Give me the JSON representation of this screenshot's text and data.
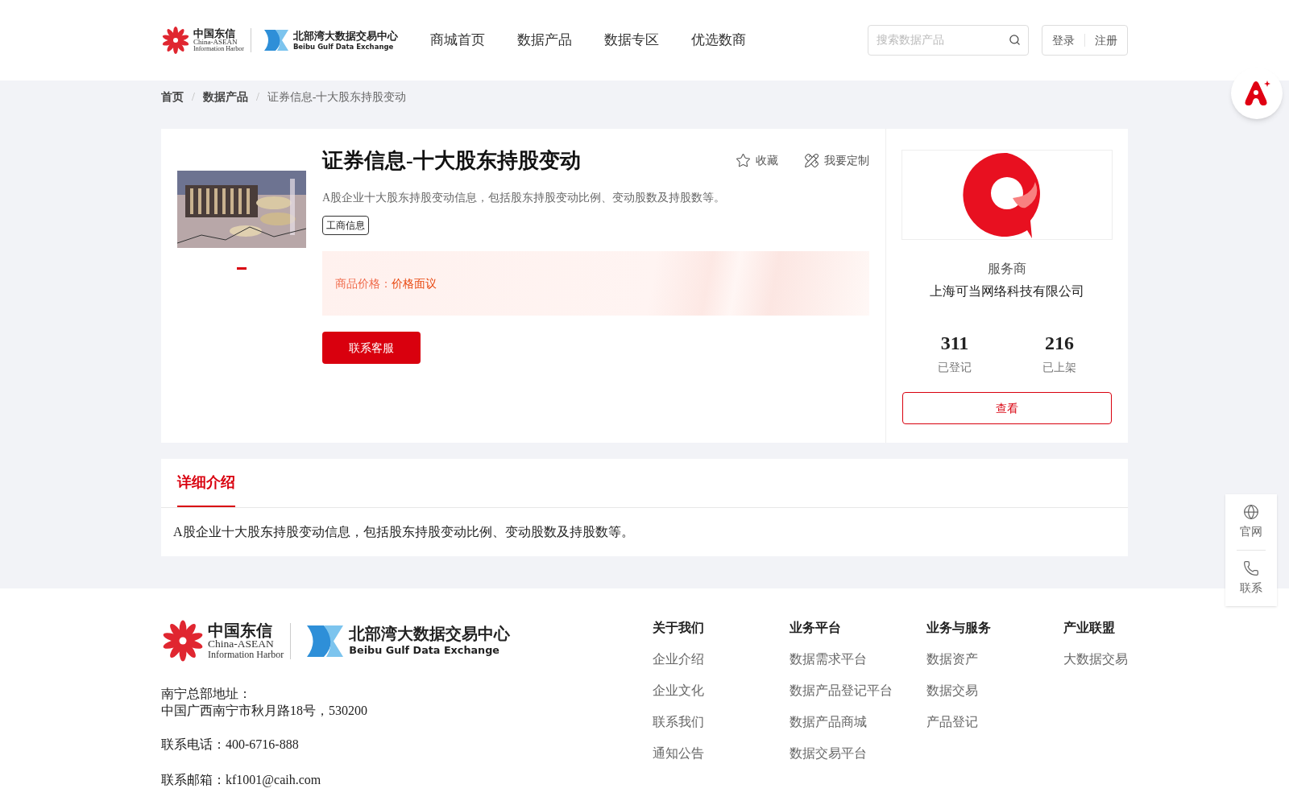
{
  "header": {
    "logo": {
      "brand_cn": "中国东信",
      "brand_en": "China-ASEAN",
      "brand_sub": "Information Harbor",
      "exchange_cn": "北部湾大数据交易中心",
      "exchange_en": "Beibu Gulf Data Exchange"
    },
    "nav": [
      "商城首页",
      "数据产品",
      "数据专区",
      "优选数商"
    ],
    "search": {
      "placeholder": "搜索数据产品"
    },
    "auth": [
      "登录",
      "注册"
    ]
  },
  "breadcrumb": [
    {
      "label": "首页"
    },
    {
      "separator": "/",
      "label": "数据产品"
    },
    {
      "separator": "/",
      "label": "证券信息-十大股东持股变动"
    }
  ],
  "product": {
    "title": "证券信息-十大股东持股变动",
    "actions": [
      {
        "label": "收藏",
        "kind": "star"
      },
      {
        "label": "我要定制",
        "kind": "customize"
      }
    ],
    "description": "A股企业十大股东持股变动信息，包括股东持股变动比例、变动股数及持股数等。",
    "tags": [
      "工商信息"
    ],
    "price_label": "商品价格：",
    "price_value": "价格面议",
    "contact_button": "联系客服"
  },
  "provider": {
    "role": "服务商",
    "name": "上海可当网络科技有限公司",
    "stats": [
      {
        "value": "311",
        "label": "已登记"
      },
      {
        "value": "216",
        "label": "已上架"
      }
    ],
    "view_button": "查看"
  },
  "detail": {
    "tabs": [
      {
        "label": "详细介绍",
        "selected": true
      }
    ],
    "body": "A股企业十大股东持股变动信息，包括股东持股变动比例、变动股数及持股数等。"
  },
  "footer": {
    "logo": {
      "brand_cn": "中国东信",
      "brand_en": "China-ASEAN",
      "brand_sub": "Information Harbor",
      "exchange_cn": "北部湾大数据交易中心",
      "exchange_en": "Beibu Gulf Data Exchange"
    },
    "address_label": "南宁总部地址：",
    "address": "中国广西南宁市秋月路18号，530200",
    "phone": "联系电话：400-6716-888",
    "email": "联系邮箱：kf1001@caih.com",
    "columns": [
      {
        "heading": "关于我们",
        "links": [
          "企业介绍",
          "企业文化",
          "联系我们",
          "通知公告"
        ]
      },
      {
        "heading": "业务平台",
        "links": [
          "数据需求平台",
          "数据产品登记平台",
          "数据产品商城",
          "数据交易平台"
        ]
      },
      {
        "heading": "业务与服务",
        "links": [
          "数据资产",
          "数据交易",
          "产品登记"
        ]
      },
      {
        "heading": "产业联盟",
        "links": [
          "大数据交易"
        ]
      }
    ]
  },
  "side_panel": [
    {
      "label": "官网",
      "kind": "globe"
    },
    {
      "label": "联系",
      "kind": "phone"
    }
  ]
}
